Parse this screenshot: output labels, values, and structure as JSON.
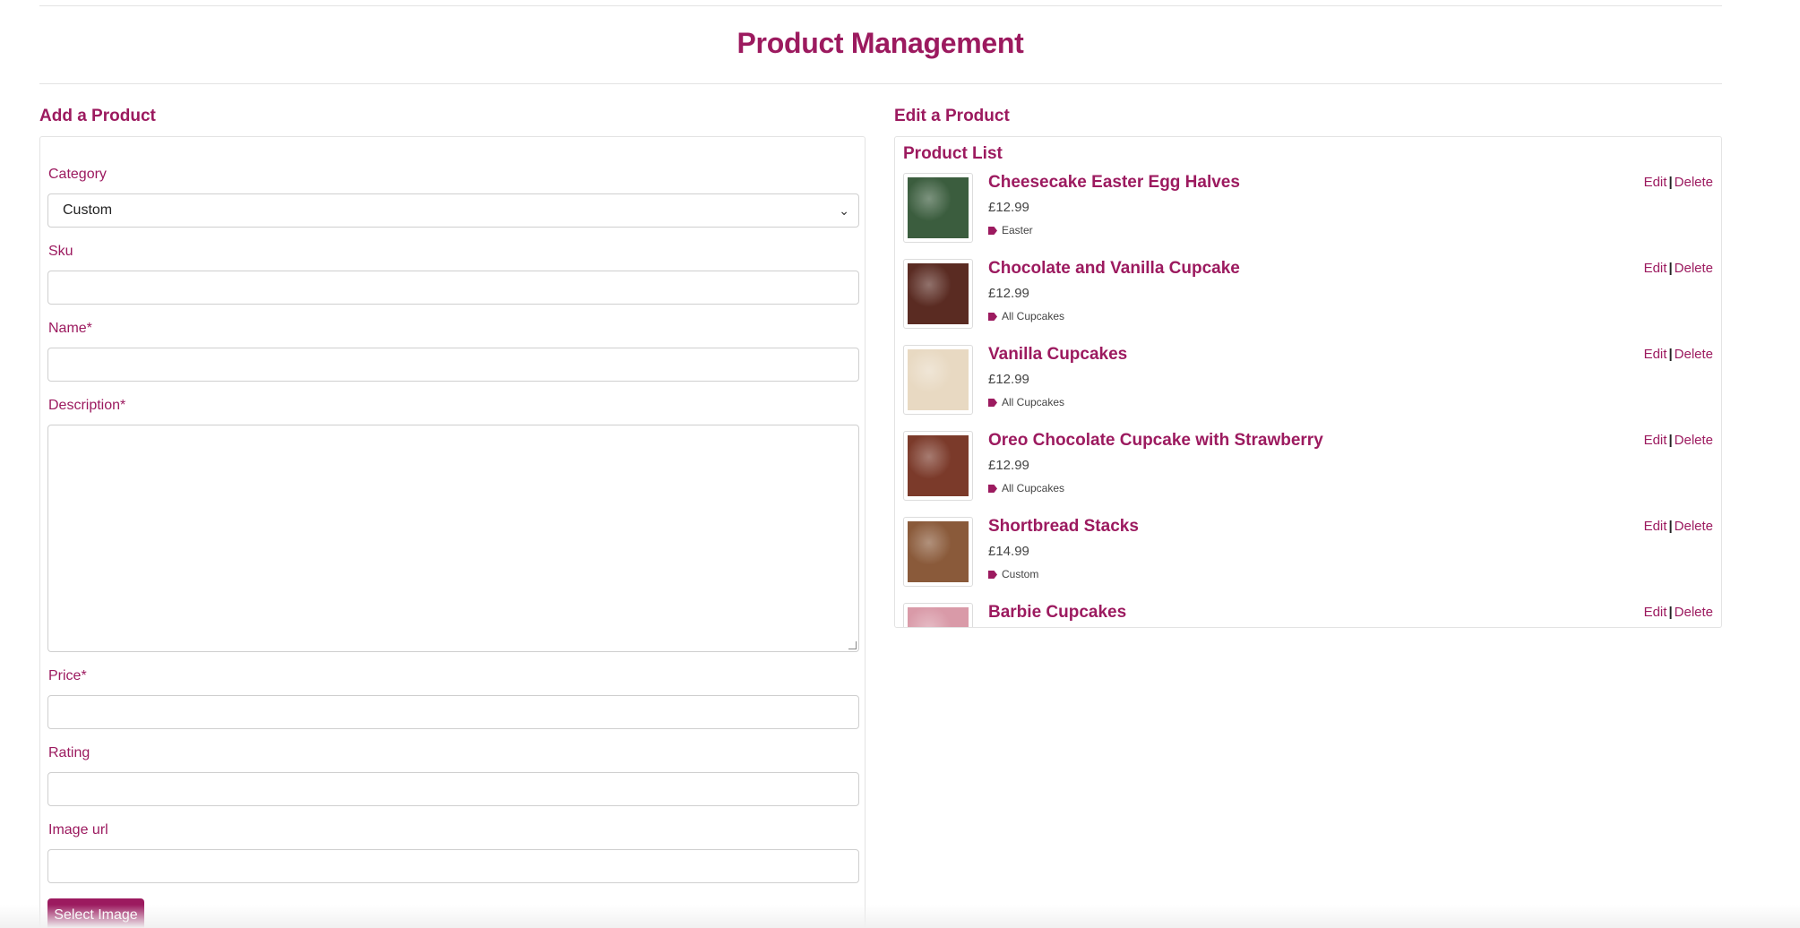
{
  "page": {
    "title": "Product Management"
  },
  "add_product": {
    "heading": "Add a Product",
    "fields": {
      "category": {
        "label": "Category",
        "value": "Custom"
      },
      "sku": {
        "label": "Sku",
        "value": ""
      },
      "name": {
        "label": "Name*",
        "value": ""
      },
      "description": {
        "label": "Description*",
        "value": ""
      },
      "price": {
        "label": "Price*",
        "value": ""
      },
      "rating": {
        "label": "Rating",
        "value": ""
      },
      "image_url": {
        "label": "Image url",
        "value": ""
      }
    },
    "select_image_label": "Select Image"
  },
  "edit_product": {
    "heading": "Edit a Product",
    "list_title": "Product List",
    "edit_label": "Edit",
    "separator": "|",
    "delete_label": "Delete",
    "products": [
      {
        "name": "Cheesecake Easter Egg Halves",
        "price": "£12.99",
        "category": "Easter",
        "thumb_color": "#3b5d3e"
      },
      {
        "name": "Chocolate and Vanilla Cupcake",
        "price": "£12.99",
        "category": "All Cupcakes",
        "thumb_color": "#5a2b22"
      },
      {
        "name": "Vanilla Cupcakes",
        "price": "£12.99",
        "category": "All Cupcakes",
        "thumb_color": "#e8d9c2"
      },
      {
        "name": "Oreo Chocolate Cupcake with Strawberry",
        "price": "£12.99",
        "category": "All Cupcakes",
        "thumb_color": "#7b3a2a"
      },
      {
        "name": "Shortbread Stacks",
        "price": "£14.99",
        "category": "Custom",
        "thumb_color": "#8a5a3a"
      },
      {
        "name": "Barbie Cupcakes",
        "price": "",
        "category": "",
        "thumb_color": "#d99aa8"
      }
    ]
  },
  "colors": {
    "accent": "#9c1a5f",
    "border": "#e3e3e3"
  }
}
